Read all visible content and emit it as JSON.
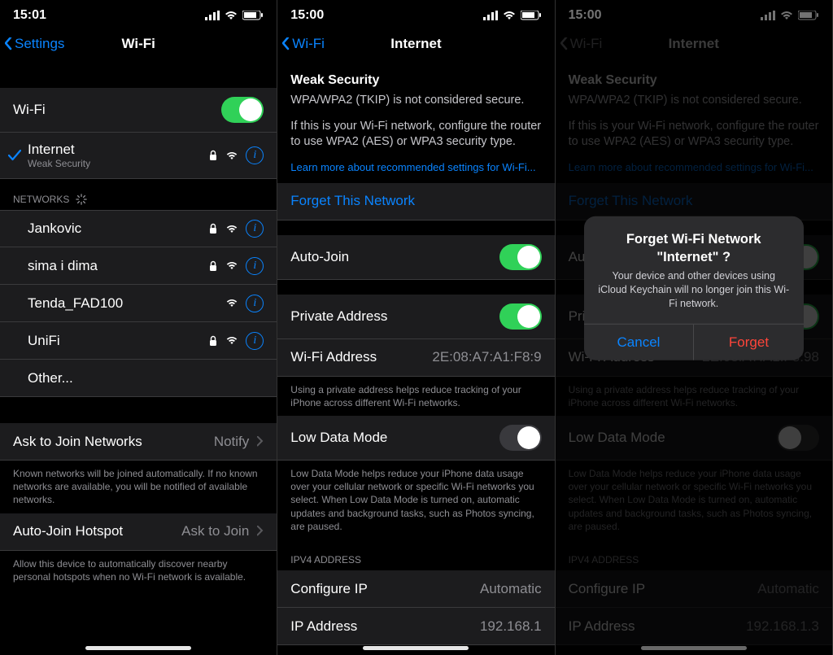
{
  "pane1": {
    "time": "15:01",
    "back": "Settings",
    "title": "Wi-Fi",
    "wifi_label": "Wi-Fi",
    "connected": {
      "name": "Internet",
      "sub": "Weak Security"
    },
    "networks_header": "NETWORKS",
    "networks": [
      {
        "name": "Jankovic",
        "locked": true
      },
      {
        "name": "sima i dima",
        "locked": true
      },
      {
        "name": "Tenda_FAD100",
        "locked": false
      },
      {
        "name": "UniFi",
        "locked": true
      },
      {
        "name": "Other..."
      }
    ],
    "ask_label": "Ask to Join Networks",
    "ask_value": "Notify",
    "ask_footer": "Known networks will be joined automatically. If no known networks are available, you will be notified of available networks.",
    "hotspot_label": "Auto-Join Hotspot",
    "hotspot_value": "Ask to Join",
    "hotspot_footer": "Allow this device to automatically discover nearby personal hotspots when no Wi-Fi network is available."
  },
  "detail": {
    "time": "15:00",
    "back": "Wi-Fi",
    "title": "Internet",
    "warn_title": "Weak Security",
    "warn_line1": "WPA/WPA2 (TKIP) is not considered secure.",
    "warn_line2": "If this is your Wi-Fi network, configure the router to use WPA2 (AES) or WPA3 security type.",
    "warn_link": "Learn more about recommended settings for Wi-Fi...",
    "forget": "Forget This Network",
    "auto_join": "Auto-Join",
    "private_addr": "Private Address",
    "wifi_addr_label": "Wi-Fi Address",
    "wifi_addr_val2": "2E:08:A7:A1:F8:9",
    "wifi_addr_val3": "2E:08:A7:A1:F8:98",
    "private_footer": "Using a private address helps reduce tracking of your iPhone across different Wi-Fi networks.",
    "low_data": "Low Data Mode",
    "low_data_footer": "Low Data Mode helps reduce your iPhone data usage over your cellular network or specific Wi-Fi networks you select. When Low Data Mode is turned on, automatic updates and background tasks, such as Photos syncing, are paused.",
    "ipv4_header": "IPV4 ADDRESS",
    "configure_ip": "Configure IP",
    "configure_ip_val": "Automatic",
    "ip_addr": "IP Address",
    "ip_addr_val2": "192.168.1",
    "ip_addr_val3": "192.168.1.3"
  },
  "alert": {
    "title1": "Forget Wi-Fi Network",
    "title2": "\"Internet\" ?",
    "msg": "Your device and other devices using iCloud Keychain will no longer join this Wi-Fi network.",
    "cancel": "Cancel",
    "forget": "Forget"
  }
}
